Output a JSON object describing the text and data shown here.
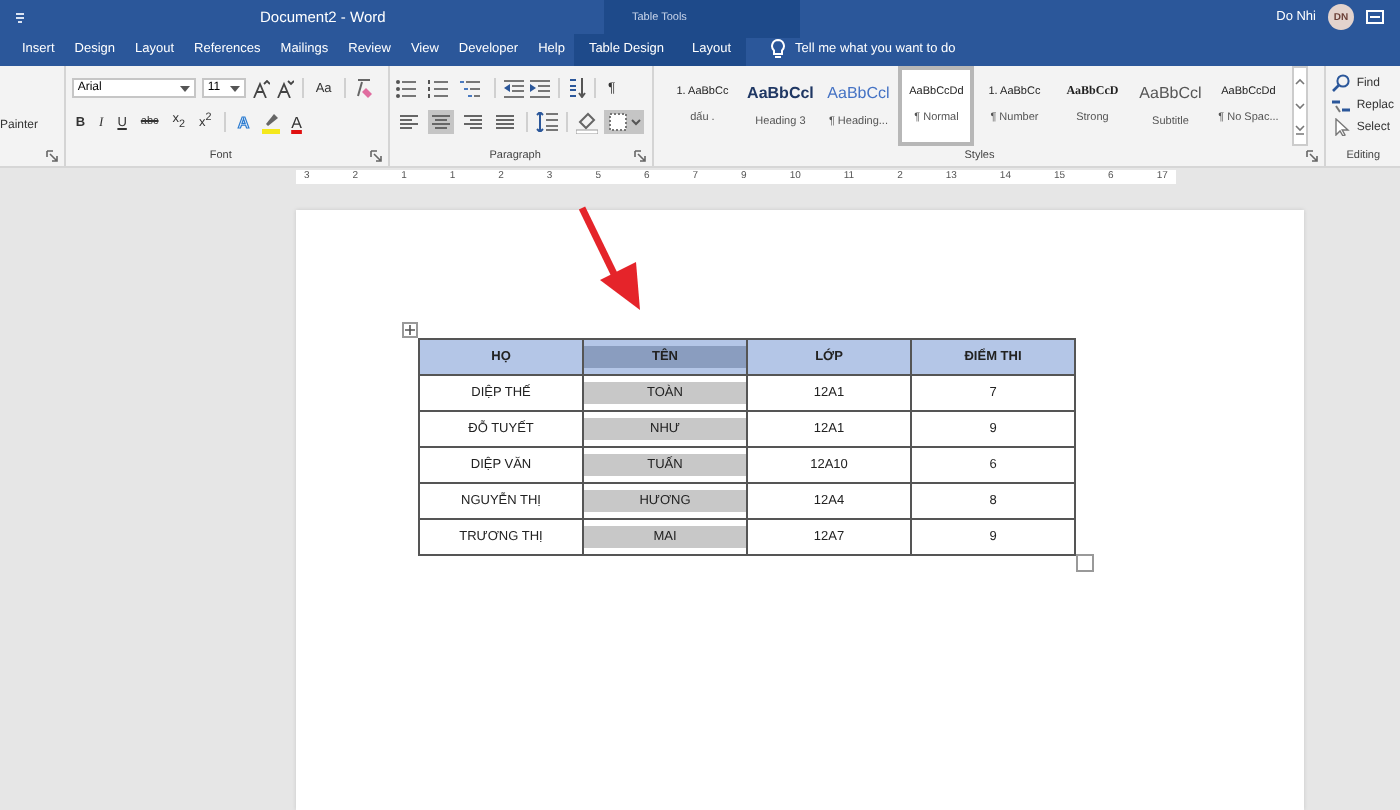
{
  "title_bar": {
    "title": "Document2  -  Word",
    "context_label": "Table Tools",
    "user": "Do Nhi",
    "avatar": "DN"
  },
  "menu_tabs": [
    {
      "label": "Insert",
      "selected": false,
      "contextual": false
    },
    {
      "label": "Design",
      "selected": false,
      "contextual": false
    },
    {
      "label": "Layout",
      "selected": false,
      "contextual": false
    },
    {
      "label": "References",
      "selected": false,
      "contextual": false
    },
    {
      "label": "Mailings",
      "selected": false,
      "contextual": false
    },
    {
      "label": "Review",
      "selected": false,
      "contextual": false
    },
    {
      "label": "View",
      "selected": false,
      "contextual": false
    },
    {
      "label": "Developer",
      "selected": false,
      "contextual": false
    },
    {
      "label": "Help",
      "selected": false,
      "contextual": false
    },
    {
      "label": "Table Design",
      "selected": false,
      "contextual": true
    },
    {
      "label": "Layout",
      "selected": false,
      "contextual": true
    }
  ],
  "tell_me": "Tell me what you want to do",
  "clipboard": {
    "label": "Painter"
  },
  "font": {
    "font_name": "Arial",
    "font_size": "11",
    "label": "Font",
    "case_button": "Aa",
    "format_buttons": [
      {
        "glyph": "B",
        "kind": "bold"
      },
      {
        "glyph": "I",
        "kind": "italic"
      },
      {
        "glyph": "U",
        "kind": "underline"
      },
      {
        "glyph": "abc",
        "kind": "strike"
      },
      {
        "glyph": "x$_{2}$",
        "kind": "script"
      },
      {
        "glyph": "x$^{2}$",
        "kind": "script"
      }
    ],
    "effect_glyph": "A",
    "color_glyph": "A"
  },
  "paragraph": {
    "label": "Paragraph",
    "marks_glyph": "¶",
    "alignment": [
      {
        "kind": "left",
        "selected": false
      },
      {
        "kind": "center",
        "selected": true
      },
      {
        "kind": "right",
        "selected": false
      },
      {
        "kind": "justify",
        "selected": false
      }
    ]
  },
  "styles": {
    "label": "Styles",
    "items": [
      {
        "preview": "1. AaBbCc",
        "name": "dấu .",
        "kind": "list",
        "selected": false
      },
      {
        "preview": "AaBbCcl",
        "name": "Heading 3",
        "kind": "heading",
        "selected": false
      },
      {
        "preview": "AaBbCcl",
        "name": "¶ Heading...",
        "kind": "heading-blue",
        "selected": false
      },
      {
        "preview": "AaBbCcDd",
        "name": "¶ Normal",
        "kind": "normal",
        "selected": true
      },
      {
        "preview": "1. AaBbCc",
        "name": "¶ Number",
        "kind": "list",
        "selected": false
      },
      {
        "preview": "AaBbCcD",
        "name": "Strong",
        "kind": "strong",
        "selected": false
      },
      {
        "preview": "AaBbCcl",
        "name": "Subtitle",
        "kind": "subtitle",
        "selected": false
      },
      {
        "preview": "AaBbCcDd",
        "name": "¶ No Spac...",
        "kind": "normal",
        "selected": false
      }
    ]
  },
  "editing": {
    "label": "Editing",
    "items": [
      {
        "label": "Find",
        "kind": "find"
      },
      {
        "label": "Replac",
        "kind": "replace"
      },
      {
        "label": "Select",
        "kind": "select"
      }
    ]
  },
  "ruler": [
    "3",
    "2",
    "1",
    "1",
    "2",
    "3",
    "5",
    "6",
    "7",
    "9",
    "10",
    "11",
    "2",
    "13",
    "14",
    "15",
    "6",
    "17"
  ],
  "table": {
    "columns": [
      {
        "label": "HỌ",
        "selected": false
      },
      {
        "label": "TÊN",
        "selected": true
      },
      {
        "label": "LỚP",
        "selected": false
      },
      {
        "label": "ĐIỂM THI",
        "selected": false
      }
    ],
    "rows": [
      [
        "DIỆP THẾ",
        "TOÀN",
        "12A1",
        "7"
      ],
      [
        "ĐỖ TUYẾT",
        "NHƯ",
        "12A1",
        "9"
      ],
      [
        "DIỆP VĂN",
        "TUẤN",
        "12A10",
        "6"
      ],
      [
        "NGUYỄN THỊ",
        "HƯƠNG",
        "12A4",
        "8"
      ],
      [
        "TRƯƠNG THỊ",
        "MAI",
        "12A7",
        "9"
      ]
    ]
  }
}
